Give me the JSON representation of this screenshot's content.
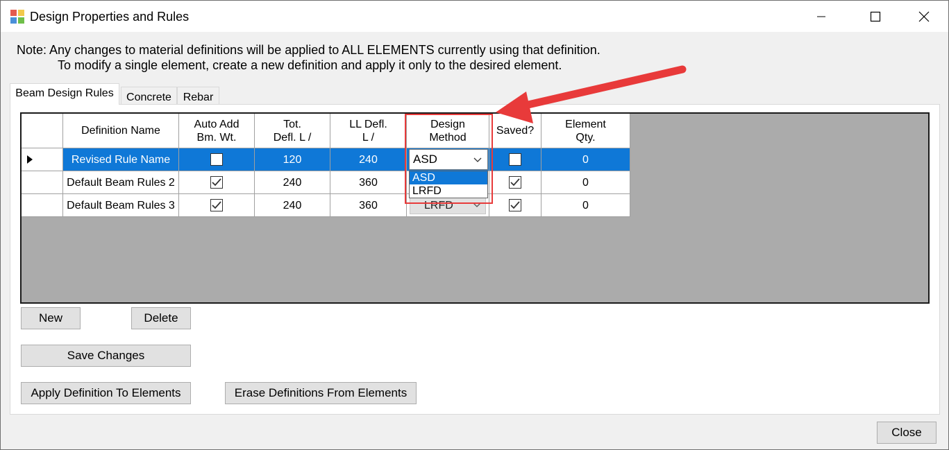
{
  "window": {
    "title": "Design Properties and Rules",
    "controls": [
      "minimize-icon",
      "maximize-icon",
      "close-icon"
    ]
  },
  "note": {
    "line1": "Note:  Any changes to material definitions will be applied to ALL ELEMENTS currently using that definition.",
    "line2": "To modify a single element, create a new definition and apply it only to the desired element."
  },
  "tabs": [
    {
      "label": "Beam Design Rules",
      "active": true
    },
    {
      "label": "Concrete",
      "active": false
    },
    {
      "label": "Rebar",
      "active": false
    }
  ],
  "grid": {
    "headers": {
      "name": "Definition Name",
      "auto1": "Auto Add",
      "auto2": "Bm. Wt.",
      "tot1": "Tot.",
      "tot2": "Defl. L /",
      "ll1": "LL Defl.",
      "ll2": "L /",
      "dm1": "Design",
      "dm2": "Method",
      "saved": "Saved?",
      "qty1": "Element",
      "qty2": "Qty."
    },
    "rows": [
      {
        "name": "Revised Rule Name",
        "auto_add": false,
        "tot_defl": "120",
        "ll_defl": "240",
        "method": "ASD",
        "saved": false,
        "qty": "0",
        "selected": true
      },
      {
        "name": "Default Beam Rules 2",
        "auto_add": true,
        "tot_defl": "240",
        "ll_defl": "360",
        "method": "",
        "saved": true,
        "qty": "0",
        "selected": false
      },
      {
        "name": "Default Beam Rules 3",
        "auto_add": true,
        "tot_defl": "240",
        "ll_defl": "360",
        "method": "LRFD",
        "saved": true,
        "qty": "0",
        "selected": false
      }
    ],
    "dropdown_options": [
      "ASD",
      "LRFD"
    ],
    "dropdown_highlighted": "ASD"
  },
  "buttons": {
    "new": "New",
    "delete": "Delete",
    "save": "Save Changes",
    "apply": "Apply Definition To Elements",
    "erase": "Erase Definitions From Elements",
    "close": "Close"
  },
  "colors": {
    "selection": "#0f78d7",
    "annotation": "#e83a3a",
    "grid_background": "#ababab"
  }
}
